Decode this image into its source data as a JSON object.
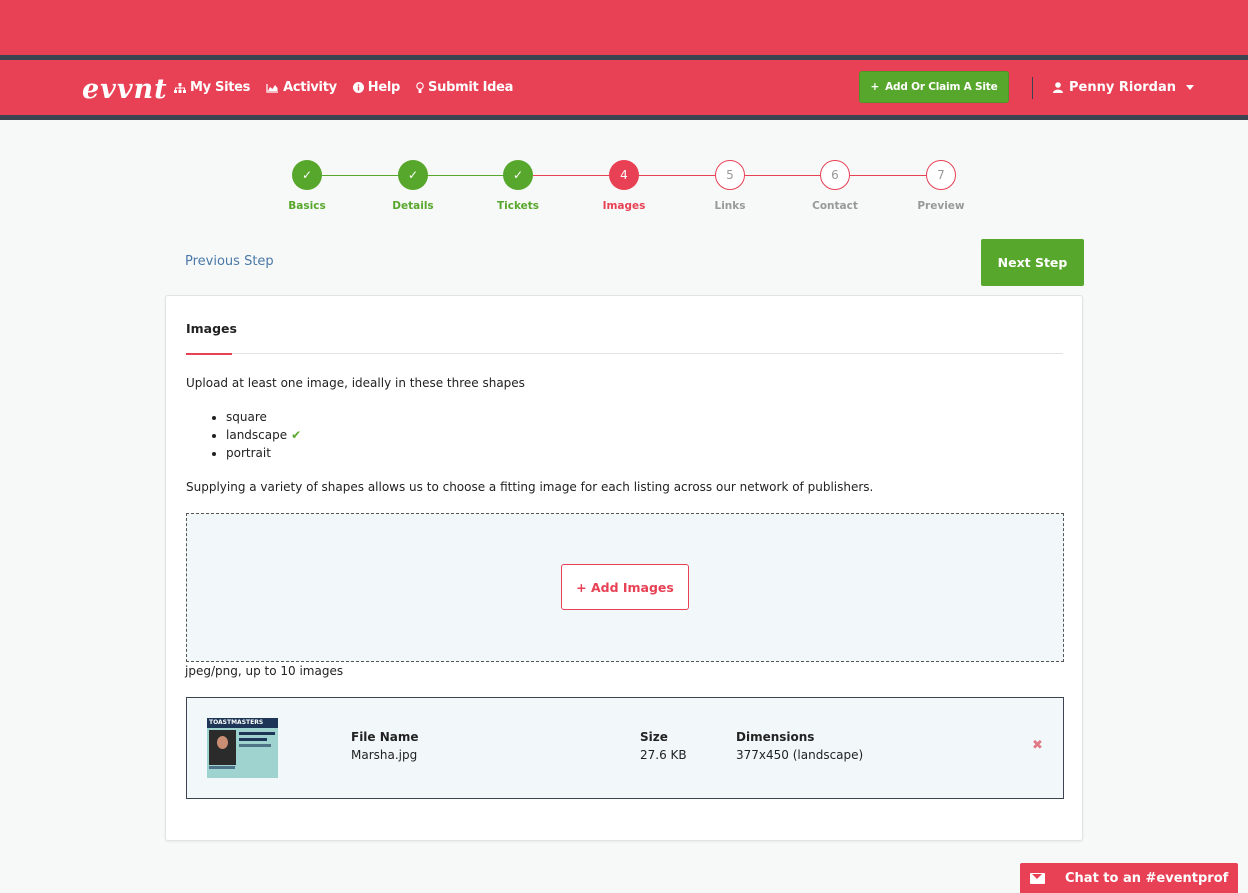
{
  "brand": {
    "logo": "evvnt",
    "accent": "#e84155",
    "success": "#58a72d",
    "dark": "#3b4450"
  },
  "nav": {
    "links": [
      {
        "label": "My Sites",
        "icon": "sitemap-icon"
      },
      {
        "label": "Activity",
        "icon": "area-chart-icon"
      },
      {
        "label": "Help",
        "icon": "info-circle-icon"
      },
      {
        "label": "Submit Idea",
        "icon": "lightbulb-icon"
      }
    ],
    "add_site": "Add Or Claim A Site",
    "user": "Penny Riordan"
  },
  "stepper": {
    "steps": [
      {
        "number": "✓",
        "label": "Basics",
        "state": "done"
      },
      {
        "number": "✓",
        "label": "Details",
        "state": "done"
      },
      {
        "number": "✓",
        "label": "Tickets",
        "state": "done"
      },
      {
        "number": "4",
        "label": "Images",
        "state": "current"
      },
      {
        "number": "5",
        "label": "Links",
        "state": "todo"
      },
      {
        "number": "6",
        "label": "Contact",
        "state": "todo"
      },
      {
        "number": "7",
        "label": "Preview",
        "state": "todo"
      }
    ]
  },
  "actions": {
    "previous": "Previous Step",
    "next": "Next Step"
  },
  "images_panel": {
    "title": "Images",
    "intro": "Upload at least one image, ideally in these three shapes",
    "shapes": [
      {
        "label": "square",
        "done": false
      },
      {
        "label": "landscape",
        "done": true
      },
      {
        "label": "portrait",
        "done": false
      }
    ],
    "variety_note": "Supplying a variety of shapes allows us to choose a fitting image for each listing across our network of publishers.",
    "add_button": "+ Add Images",
    "hint": "jpeg/png, up to 10 images",
    "columns": {
      "file_name": "File Name",
      "size": "Size",
      "dimensions": "Dimensions"
    },
    "files": [
      {
        "thumb_title": "TOASTMASTERS",
        "file_name": "Marsha.jpg",
        "size": "27.6 KB",
        "dimensions": "377x450 (landscape)"
      }
    ]
  },
  "chat": {
    "label": "Chat to an #eventprof"
  }
}
